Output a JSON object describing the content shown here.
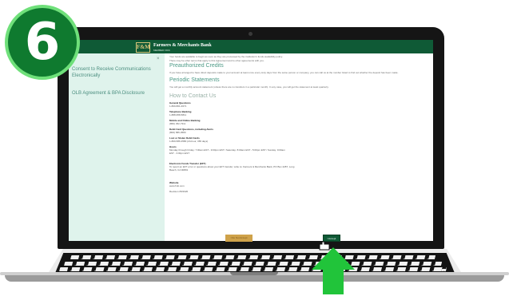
{
  "step": {
    "number": "6"
  },
  "app": {
    "brand": "Farmers & Merchants Bank",
    "brand_sub": "MEMBER FDIC",
    "logo_text": "F&M"
  },
  "sidebar": {
    "items": [
      {
        "label": "Consent to Receive Communications Electronically"
      },
      {
        "label": "OLB Agreement & BPA Disclosure"
      }
    ]
  },
  "content": {
    "bullet_1": "Your funds are available to begin as soon as they are processed by the institution's funds availability policy.",
    "para_1": "There may be other terms that apply to this Agreement and to other agreements with you.",
    "h_preauth": "Preauthorized Credits",
    "para_preauth": "If you have arranged to have direct deposits made to your account at least once every sixty days from the same person or company, you can call us at the number listed to find out whether the deposit has been made.",
    "h_periodic": "Periodic Statements",
    "para_periodic": "You will get a monthly account statement (unless there are no transfers in a particular month). In any case, you will get the statement at least quarterly.",
    "h_contact": "How to Contact Us",
    "contacts": [
      {
        "label": "General Questions",
        "value": "1-800-801-4671"
      },
      {
        "label": "Telephone Banking",
        "value": "1-888-958-5811"
      },
      {
        "label": "Mobile and Online Banking",
        "value": "(866) 452-7311"
      },
      {
        "label": "Debit Card Questions, including Alerts",
        "value": "(800) 586-3580"
      },
      {
        "label": "Lost or Stolen Debit Cards",
        "value": "1-800-586-3580 (24-hour, 365 days)"
      },
      {
        "label": "Hours",
        "value": "Monday through Friday: 7:00am EST - 9:00pm EST / Saturday: 8:00am EST - 5:00pm EST / Sunday: 9:00am EST - 3:00pm EST"
      },
      {
        "label": "Electronic Funds Transfer (EFT)",
        "value": "To report an EFT error or questions about your EFT transfer, write to: Farmers & Merchants Bank, PO Box 2287, Long Beach, CA 90801"
      },
      {
        "label": "Website",
        "value": "www.fmb.com"
      }
    ],
    "revision": "Revision 05/2020"
  },
  "buttons": {
    "decline": "I Do Not Accept",
    "accept": "I Accept"
  },
  "colors": {
    "header_green": "#0f5a36",
    "sidebar_bg": "#dff3ec",
    "accent_teal": "#4d9a86",
    "decline_gold": "#cfa24a",
    "arrow_green": "#21c43a",
    "badge_green": "#0f7a2f"
  }
}
